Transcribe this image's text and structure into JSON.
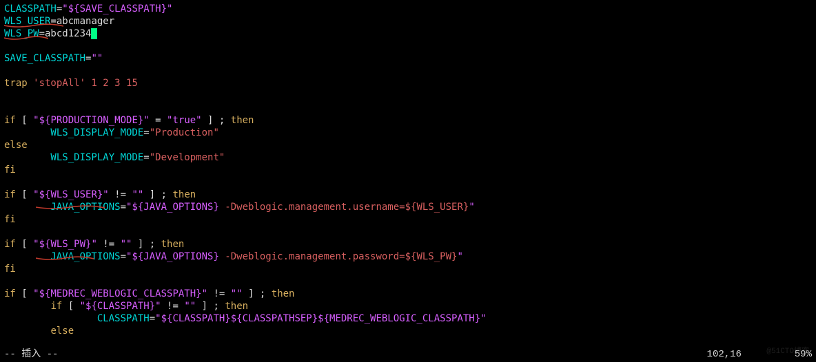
{
  "code": {
    "l1": {
      "a": "CLASSPATH",
      "b": "=",
      "c": "\"${SAVE_CLASSPATH}\""
    },
    "l2": {
      "a": "WLS_USER",
      "b": "=abcmanager"
    },
    "l3": {
      "a": "WLS_PW",
      "b": "=abcd1234"
    },
    "l4": "",
    "l5": {
      "a": "SAVE_CLASSPATH",
      "b": "=",
      "c": "\"\""
    },
    "l6": "",
    "l7": {
      "a": "trap",
      "b": " 'stopAll' ",
      "c": "1 2 3 15"
    },
    "l8": "",
    "l9": "",
    "l10": {
      "a": "if",
      "b": " [ ",
      "c": "\"${PRODUCTION_MODE}\"",
      "d": " = ",
      "e": "\"true\"",
      "f": " ] ; ",
      "g": "then"
    },
    "l11": {
      "a": "        WLS_DISPLAY_MODE",
      "b": "=",
      "c": "\"Production\""
    },
    "l12": {
      "a": "else"
    },
    "l13": {
      "a": "        WLS_DISPLAY_MODE",
      "b": "=",
      "c": "\"Development\""
    },
    "l14": {
      "a": "fi"
    },
    "l15": "",
    "l16": {
      "a": "if",
      "b": " [ ",
      "c": "\"${WLS_USER}\"",
      "d": " != ",
      "e": "\"\"",
      "f": " ] ; ",
      "g": "then"
    },
    "l17": {
      "a": "        JAVA_OPTIONS",
      "b": "=",
      "c": "\"${JAVA_OPTIONS}",
      " d": " -Dweblogic.management.username=${WLS_USER}",
      "e": "\""
    },
    "l18": {
      "a": "fi"
    },
    "l19": "",
    "l20": {
      "a": "if",
      "b": " [ ",
      "c": "\"${WLS_PW}\"",
      "d": " != ",
      "e": "\"\"",
      "f": " ] ; ",
      "g": "then"
    },
    "l21": {
      "a": "        JAVA_OPTIONS",
      "b": "=",
      "c": "\"${JAVA_OPTIONS}",
      "d": " -Dweblogic.management.password=${WLS_PW}",
      "e": "\""
    },
    "l22": {
      "a": "fi"
    },
    "l23": "",
    "l24": {
      "a": "if",
      "b": " [ ",
      "c": "\"${MEDREC_WEBLOGIC_CLASSPATH}\"",
      "d": " != ",
      "e": "\"\"",
      "f": " ] ; ",
      "g": "then"
    },
    "l25": {
      "a": "        ",
      "b": "if",
      "c": " [ ",
      "d": "\"${CLASSPATH}\"",
      "e": " != ",
      "f": "\"\"",
      "g": " ] ; ",
      "h": "then"
    },
    "l26": {
      "a": "                CLASSPATH",
      "b": "=",
      "c": "\"${CLASSPATH}${CLASSPATHSEP}${MEDREC_WEBLOGIC_CLASSPATH}\""
    },
    "l27": {
      "a": "        ",
      "b": "else"
    }
  },
  "status": {
    "mode": "-- 插入 --",
    "pos": "102,16",
    "pct": "59%"
  },
  "watermark": "@51CTO博客"
}
